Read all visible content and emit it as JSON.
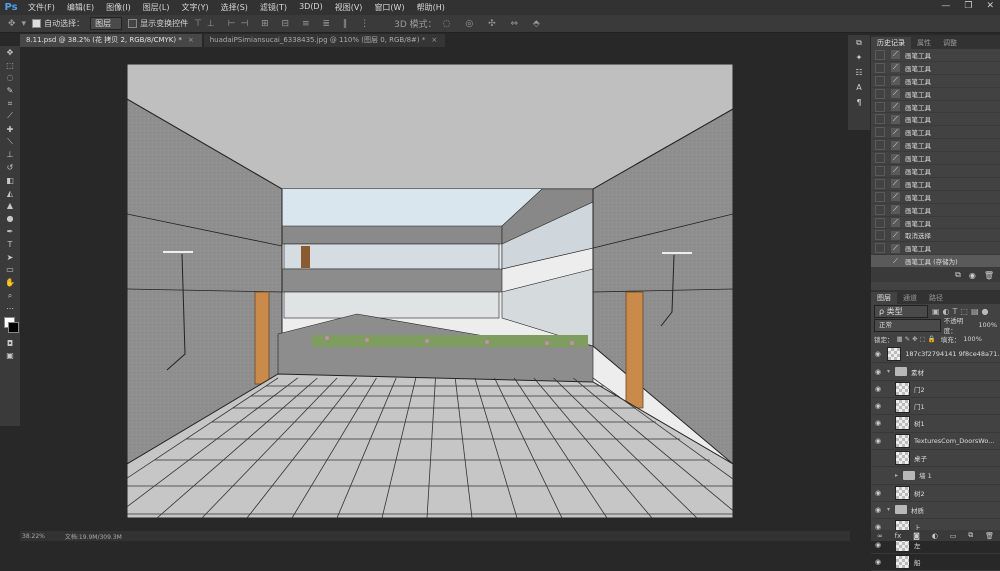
{
  "app": {
    "logo": "Ps"
  },
  "menu": [
    "文件(F)",
    "编辑(E)",
    "图像(I)",
    "图层(L)",
    "文字(Y)",
    "选择(S)",
    "滤镜(T)",
    "3D(D)",
    "视图(V)",
    "窗口(W)",
    "帮助(H)"
  ],
  "window_controls": {
    "minimize": "—",
    "restore": "❐",
    "close": "✕"
  },
  "options": {
    "auto_select_label": "自动选择：",
    "auto_select_value": "图层",
    "show_transform_label": "显示变换控件",
    "mode_3d_label": "3D 模式："
  },
  "tabs": [
    {
      "label": "8.11.psd @ 38.2% (花 拷贝 2, RGB/8/CMYK) *",
      "close": "×"
    },
    {
      "label": "huadaiPSimiansucai_6338435.jpg @ 110% (图层 0, RGB/8#) *",
      "close": "×"
    }
  ],
  "status": {
    "zoom": "38.22%",
    "doc": "文档:19.9M/309.3M"
  },
  "history_panel": {
    "tabs": [
      "历史记录",
      "属性",
      "调整"
    ],
    "items": [
      "画笔工具",
      "画笔工具",
      "画笔工具",
      "画笔工具",
      "画笔工具",
      "画笔工具",
      "画笔工具",
      "画笔工具",
      "画笔工具",
      "画笔工具",
      "画笔工具",
      "画笔工具",
      "画笔工具",
      "画笔工具",
      "取消选择",
      "画笔工具",
      "画笔工具 (存储为)"
    ],
    "selected_index": 16
  },
  "layers_panel": {
    "tabs": [
      "图层",
      "通道",
      "路径"
    ],
    "filter_label": "ρ 类型",
    "blend_mode": "正常",
    "opacity_label": "不透明度：",
    "opacity": "100%",
    "lock_label": "锁定：",
    "fill_label": "填充：",
    "fill": "100%",
    "layers": [
      {
        "name": "187c3f2794141 9f8ce48a71...",
        "kind": "thumb",
        "indent": 0,
        "eye": true
      },
      {
        "name": "素材",
        "kind": "folder",
        "indent": 0,
        "eye": true,
        "open": true
      },
      {
        "name": "门2",
        "kind": "thumb",
        "indent": 1,
        "eye": true
      },
      {
        "name": "门1",
        "kind": "thumb",
        "indent": 1,
        "eye": true
      },
      {
        "name": "树1",
        "kind": "thumb",
        "indent": 1,
        "eye": true
      },
      {
        "name": "TexturesCom_DoorsWo...",
        "kind": "thumb",
        "indent": 1,
        "eye": true
      },
      {
        "name": "桌子",
        "kind": "thumb",
        "indent": 1,
        "eye": false
      },
      {
        "name": "墙 1",
        "kind": "folder",
        "indent": 1,
        "eye": false,
        "open": false
      },
      {
        "name": "树2",
        "kind": "thumb",
        "indent": 1,
        "eye": true
      },
      {
        "name": "材质",
        "kind": "folder",
        "indent": 0,
        "eye": true,
        "open": true
      },
      {
        "name": "上",
        "kind": "thumb",
        "indent": 1,
        "eye": true
      },
      {
        "name": "左",
        "kind": "thumb",
        "indent": 1,
        "eye": true
      },
      {
        "name": "船",
        "kind": "thumb",
        "indent": 1,
        "eye": true
      }
    ]
  },
  "colors": {
    "sky": "#d8e6ee",
    "wall": "#8f8f8f",
    "ceiling": "#bdbdbd",
    "floor": "#c4c4c4",
    "door": "#c88a4a",
    "plants": "#7a9a5a"
  }
}
